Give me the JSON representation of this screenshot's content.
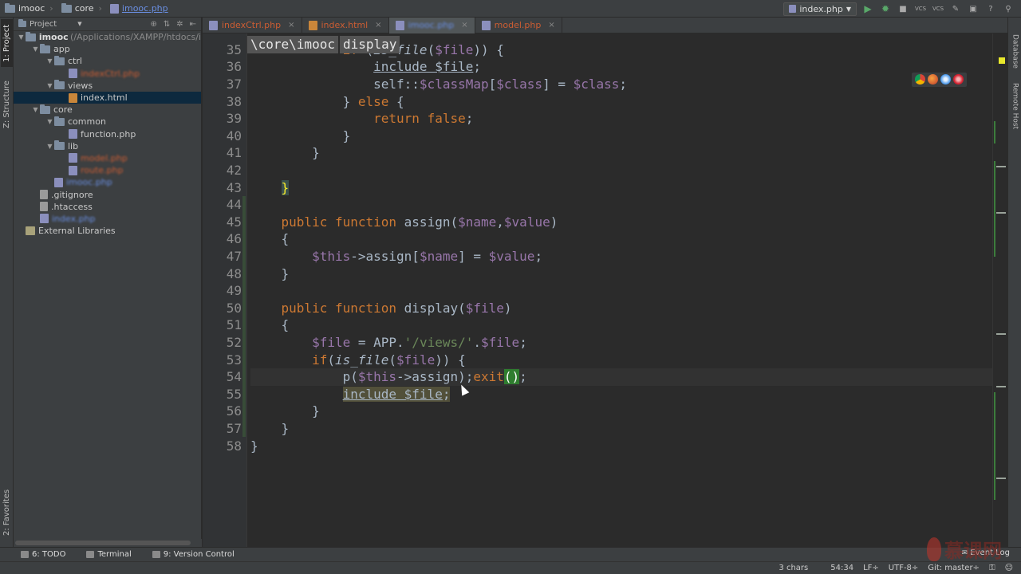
{
  "navbar": {
    "crumbs": [
      {
        "label": "imooc",
        "icon": "folder-icon"
      },
      {
        "label": "core",
        "icon": "folder-icon"
      },
      {
        "label": "imooc.php",
        "icon": "php-file-icon"
      }
    ],
    "run_config": "index.php",
    "vcs_label_1": "VCS",
    "vcs_label_2": "VCS"
  },
  "left_strip": {
    "project_tab": "1: Project",
    "structure_tab": "Z: Structure",
    "favorites_tab": "2: Favorites"
  },
  "project_panel": {
    "header": "Project",
    "tree": [
      {
        "label": "imooc",
        "sub": "(/Applications/XAMPP/htdocs/i",
        "depth": 0,
        "expanded": true,
        "icon": "folder",
        "style": "bold"
      },
      {
        "label": "app",
        "depth": 1,
        "expanded": true,
        "icon": "folder"
      },
      {
        "label": "ctrl",
        "depth": 2,
        "expanded": true,
        "icon": "folder"
      },
      {
        "label": "indexCtrl.php",
        "depth": 3,
        "icon": "php",
        "style": "modified blur"
      },
      {
        "label": "views",
        "depth": 2,
        "expanded": true,
        "icon": "folder"
      },
      {
        "label": "index.html",
        "depth": 3,
        "icon": "html",
        "selected": true
      },
      {
        "label": "core",
        "depth": 1,
        "expanded": true,
        "icon": "folder"
      },
      {
        "label": "common",
        "depth": 2,
        "expanded": true,
        "icon": "folder"
      },
      {
        "label": "function.php",
        "depth": 3,
        "icon": "php"
      },
      {
        "label": "lib",
        "depth": 2,
        "expanded": true,
        "icon": "folder"
      },
      {
        "label": "model.php",
        "depth": 3,
        "icon": "php",
        "style": "modified blur"
      },
      {
        "label": "route.php",
        "depth": 3,
        "icon": "php",
        "style": "modified blur"
      },
      {
        "label": "imooc.php",
        "depth": 2,
        "icon": "php",
        "style": "added blur"
      },
      {
        "label": ".gitignore",
        "depth": 1,
        "icon": "file"
      },
      {
        "label": ".htaccess",
        "depth": 1,
        "icon": "file"
      },
      {
        "label": "index.php",
        "depth": 1,
        "icon": "php",
        "style": "added blur"
      },
      {
        "label": "External Libraries",
        "depth": 0,
        "icon": "lib"
      }
    ]
  },
  "tabs": [
    {
      "label": "indexCtrl.php",
      "icon": "php",
      "style": "modified"
    },
    {
      "label": "index.html",
      "icon": "html",
      "style": "modified"
    },
    {
      "label": "imooc.php",
      "icon": "php",
      "style": "added",
      "active": true
    },
    {
      "label": "model.php",
      "icon": "php",
      "style": "modified"
    }
  ],
  "breadcrumb_popup": [
    "\\core\\imooc",
    "display"
  ],
  "editor": {
    "first_line": 35,
    "current_line": 54,
    "lines": [
      "            if (is_file($file)) {",
      "                include $file;",
      "                self::$classMap[$class] = $class;",
      "            } else {",
      "                return false;",
      "            }",
      "        }",
      "",
      "    }",
      "",
      "    public function assign($name,$value)",
      "    {",
      "        $this->assign[$name] = $value;",
      "    }",
      "",
      "    public function display($file)",
      "    {",
      "        $file = APP.'/views/'.$file;",
      "        if(is_file($file)) {",
      "            p($this->assign);exit();",
      "            include $file;",
      "        }",
      "    }",
      "}"
    ]
  },
  "right_strip": {
    "database_tab": "Database",
    "remote_tab": "Remote Host"
  },
  "toolwindows": [
    {
      "label": "6: TODO"
    },
    {
      "label": "Terminal"
    },
    {
      "label": "9: Version Control"
    }
  ],
  "event_log": "Event Log",
  "status": {
    "chars": "3 chars",
    "position": "54:34",
    "line_sep": "LF÷",
    "encoding": "UTF-8÷",
    "git": "Git: master÷"
  },
  "watermark_text": "慕课网",
  "colors": {
    "keyword": "#cc7832",
    "variable": "#9876aa",
    "function": "#ffc66d",
    "string": "#6a8759",
    "modified_file": "#cc5d33",
    "added_file": "#6a8fe3"
  }
}
